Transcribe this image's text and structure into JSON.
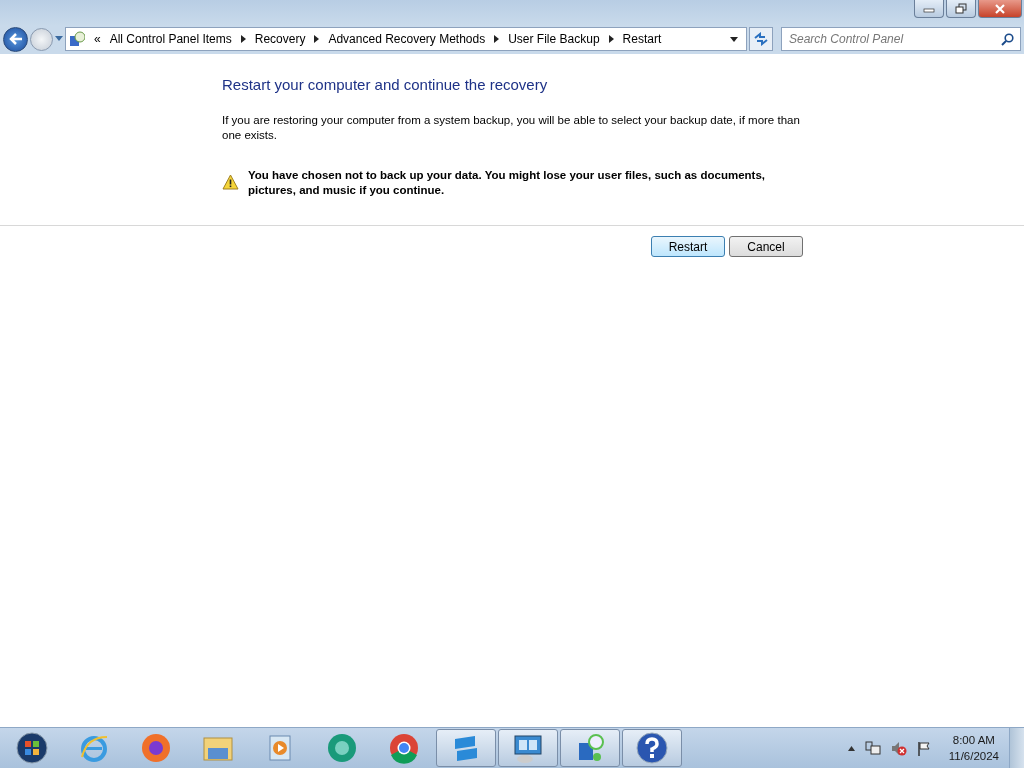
{
  "address_bar": {
    "overflow": "«",
    "crumbs": [
      "All Control Panel Items",
      "Recovery",
      "Advanced Recovery Methods",
      "User File Backup",
      "Restart"
    ]
  },
  "search": {
    "placeholder": "Search Control Panel"
  },
  "heading": "Restart your computer and continue the recovery",
  "intro": "If you are restoring your computer from a system backup, you will be able to select your backup date, if more than one exists.",
  "warning": "You have chosen not to back up your data. You might lose your user files, such as documents, pictures, and music if you continue.",
  "buttons": [
    {
      "label": "Restart",
      "default": true
    },
    {
      "label": "Cancel",
      "default": false
    }
  ],
  "taskbar": {
    "items": [
      {
        "kind": "start",
        "open": false
      },
      {
        "kind": "ie",
        "open": false
      },
      {
        "kind": "firefox",
        "open": false
      },
      {
        "kind": "folder",
        "open": false
      },
      {
        "kind": "media",
        "open": false
      },
      {
        "kind": "green",
        "open": false
      },
      {
        "kind": "chrome",
        "open": false
      },
      {
        "kind": "blue",
        "open": true
      },
      {
        "kind": "panel",
        "open": true
      },
      {
        "kind": "network",
        "open": true
      },
      {
        "kind": "help",
        "open": true
      }
    ],
    "time": "8:00 AM",
    "date": "11/6/2024"
  }
}
